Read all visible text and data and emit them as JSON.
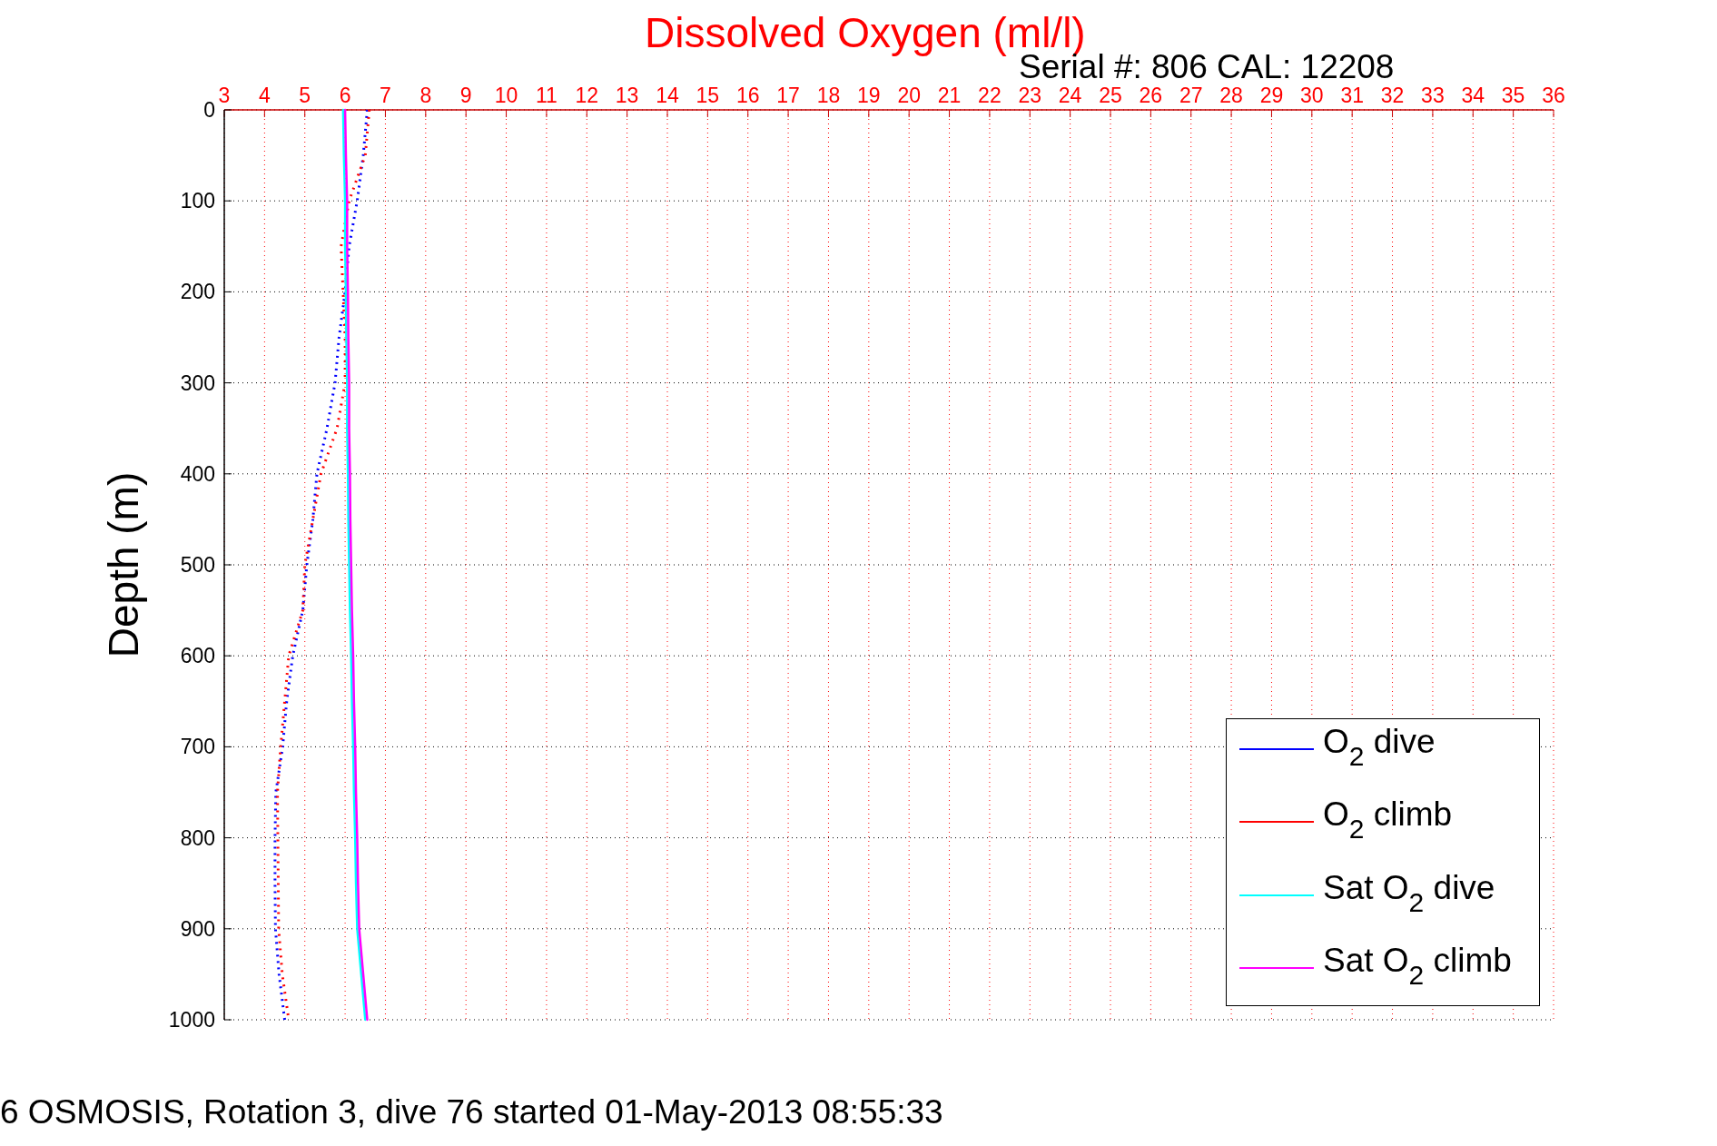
{
  "header": {
    "serial": "Serial #: 806  CAL: 12208"
  },
  "chart": {
    "chart_data": {
      "type": "line",
      "title": "Dissolved Oxygen (ml/l)",
      "ylabel": "Depth (m)",
      "orientation": "horizontal",
      "grid": true,
      "legend": "lower right",
      "x": [
        0,
        50,
        100,
        150,
        200,
        250,
        300,
        350,
        400,
        450,
        500,
        550,
        600,
        650,
        700,
        750,
        800,
        850,
        900,
        950,
        1000
      ],
      "xlim": [
        3,
        36
      ],
      "ylim": [
        1000,
        0
      ],
      "xticks": [
        3,
        4,
        5,
        6,
        7,
        8,
        9,
        10,
        11,
        12,
        13,
        14,
        15,
        16,
        17,
        18,
        19,
        20,
        21,
        22,
        23,
        24,
        25,
        26,
        27,
        28,
        29,
        30,
        31,
        32,
        33,
        34,
        35,
        36
      ],
      "yticks": [
        0,
        100,
        200,
        300,
        400,
        500,
        600,
        700,
        800,
        900,
        1000
      ],
      "series": [
        {
          "name": "O$_{2}$ dive",
          "color": "#0000ff",
          "line_style": "dotted",
          "values": [
            6.55,
            6.45,
            6.3,
            6.1,
            6.0,
            5.85,
            5.75,
            5.55,
            5.3,
            5.2,
            5.05,
            4.95,
            4.7,
            4.55,
            4.45,
            4.28,
            4.26,
            4.26,
            4.27,
            4.36,
            4.5
          ]
        },
        {
          "name": "O$_{2}$ climb",
          "color": "#ff0000",
          "line_style": "dotted",
          "values": [
            6.6,
            6.5,
            6.1,
            5.9,
            5.95,
            6.0,
            6.0,
            5.8,
            5.4,
            5.2,
            5.0,
            4.95,
            4.6,
            4.5,
            4.4,
            4.32,
            4.33,
            4.34,
            4.35,
            4.44,
            4.6
          ]
        },
        {
          "name": "Sat O$_{2}$ dive",
          "color": "#00ffff",
          "line_style": "solid",
          "values": [
            5.95,
            5.97,
            6.0,
            6.0,
            6.02,
            6.03,
            6.05,
            6.05,
            6.07,
            6.08,
            6.1,
            6.12,
            6.15,
            6.17,
            6.2,
            6.22,
            6.25,
            6.27,
            6.3,
            6.4,
            6.5
          ]
        },
        {
          "name": "Sat O$_{2}$ climb",
          "color": "#ff00ff",
          "line_style": "solid",
          "values": [
            6.0,
            6.02,
            6.05,
            6.05,
            6.07,
            6.08,
            6.1,
            6.1,
            6.12,
            6.13,
            6.15,
            6.17,
            6.2,
            6.22,
            6.25,
            6.27,
            6.3,
            6.32,
            6.35,
            6.45,
            6.55
          ]
        }
      ]
    }
  },
  "caption": "6 OSMOSIS, Rotation 3, dive 76 started 01-May-2013 08:55:33"
}
